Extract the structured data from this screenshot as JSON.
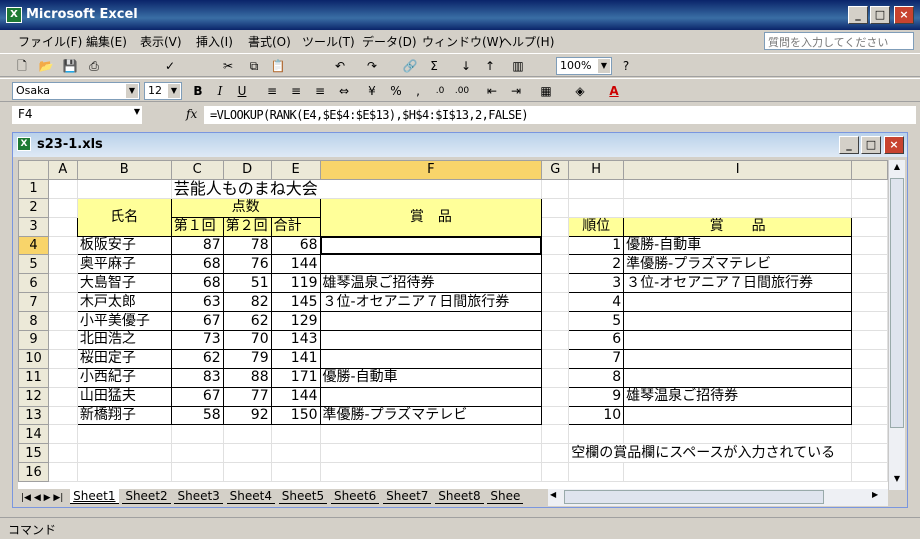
{
  "app": {
    "title": "Microsoft Excel"
  },
  "menu": [
    "ファイル(F)",
    "編集(E)",
    "表示(V)",
    "挿入(I)",
    "書式(O)",
    "ツール(T)",
    "データ(D)",
    "ウィンドウ(W)",
    "ヘルプ(H)"
  ],
  "help_box": {
    "placeholder": "質問を入力してください"
  },
  "toolbar": {
    "zoom": "100%",
    "font": "Osaka",
    "size": "12",
    "bold": "B",
    "italic": "I",
    "underline": "U",
    "percent": "%",
    "comma": ","
  },
  "formula_bar": {
    "cell": "F4",
    "fx": "fx",
    "formula": "=VLOOKUP(RANK(E4,$E$4:$E$13),$H$4:$I$13,2,FALSE)"
  },
  "workbook": {
    "title": "s23-1.xls"
  },
  "columns": [
    "A",
    "B",
    "C",
    "D",
    "E",
    "F",
    "G",
    "H",
    "I"
  ],
  "rows": [
    "1",
    "2",
    "3",
    "4",
    "5",
    "6",
    "7",
    "8",
    "9",
    "10",
    "11",
    "12",
    "13",
    "14",
    "15",
    "16"
  ],
  "sheet": {
    "title": "芸能人ものまね大会",
    "h_name": "氏名",
    "h_score": "点数",
    "h_prize": "賞　品",
    "h_r1": "第１回",
    "h_r2": "第２回",
    "h_total": "合計",
    "h_rank": "順位",
    "h_prize2": "賞　　品",
    "data": [
      [
        "板阪安子",
        "87",
        "78",
        "68",
        ""
      ],
      [
        "奥平麻子",
        "68",
        "76",
        "144",
        ""
      ],
      [
        "大島智子",
        "68",
        "51",
        "119",
        "雄琴温泉ご招待券"
      ],
      [
        "木戸太郎",
        "63",
        "82",
        "145",
        "３位-オセアニア７日間旅行券"
      ],
      [
        "小平美優子",
        "67",
        "62",
        "129",
        ""
      ],
      [
        "北田浩之",
        "73",
        "70",
        "143",
        ""
      ],
      [
        "桜田定子",
        "62",
        "79",
        "141",
        ""
      ],
      [
        "小西紀子",
        "83",
        "88",
        "171",
        "優勝-自動車"
      ],
      [
        "山田猛夫",
        "67",
        "77",
        "144",
        ""
      ],
      [
        "新橋翔子",
        "58",
        "92",
        "150",
        "準優勝-プラズマテレビ"
      ]
    ],
    "lookup": [
      [
        "1",
        "優勝-自動車"
      ],
      [
        "2",
        "準優勝-プラズマテレビ"
      ],
      [
        "3",
        "３位-オセアニア７日間旅行券"
      ],
      [
        "4",
        ""
      ],
      [
        "5",
        ""
      ],
      [
        "6",
        ""
      ],
      [
        "7",
        ""
      ],
      [
        "8",
        ""
      ],
      [
        "9",
        "雄琴温泉ご招待券"
      ],
      [
        "10",
        ""
      ]
    ],
    "note": "空欄の賞品欄にスペースが入力されている"
  },
  "tabs": [
    "Sheet1",
    "Sheet2",
    "Sheet3",
    "Sheet4",
    "Sheet5",
    "Sheet6",
    "Sheet7",
    "Sheet8",
    "Shee"
  ],
  "status": "コマンド"
}
